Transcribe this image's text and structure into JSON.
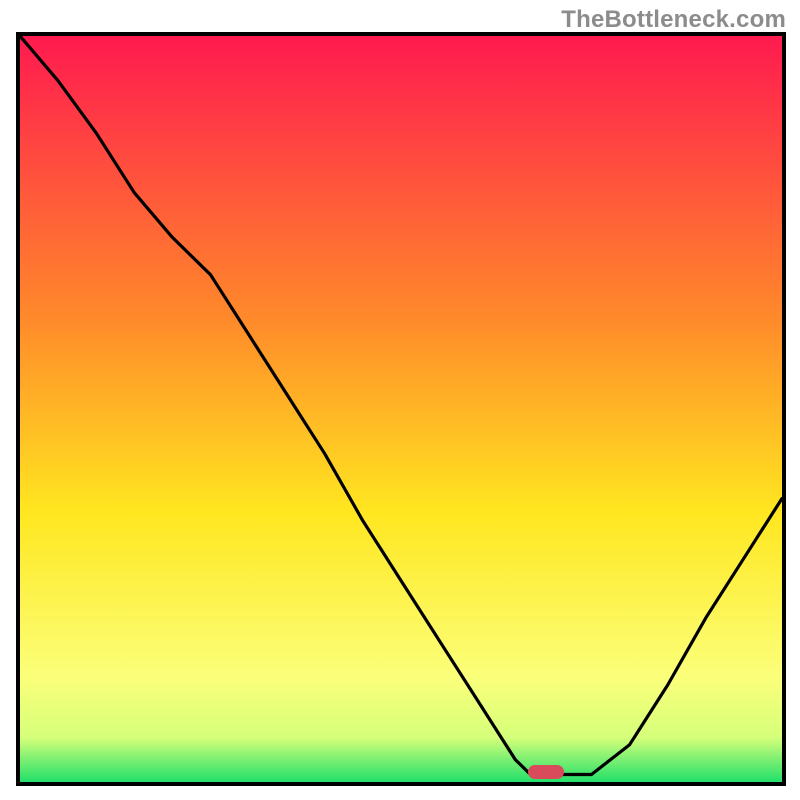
{
  "watermark": "TheBottleneck.com",
  "colors": {
    "gradient_top": "#ff1a4f",
    "gradient_mid1": "#ff8a2a",
    "gradient_mid2": "#ffe720",
    "gradient_mid3": "#fbff7a",
    "gradient_bottom": "#22e06a",
    "curve": "#000000",
    "marker": "#d94a5a",
    "frame": "#000000"
  },
  "chart_data": {
    "type": "line",
    "title": "",
    "xlabel": "",
    "ylabel": "",
    "xlim": [
      0,
      100
    ],
    "ylim": [
      0,
      100
    ],
    "series": [
      {
        "name": "curve",
        "x": [
          0,
          5,
          10,
          15,
          20,
          25,
          30,
          35,
          40,
          45,
          50,
          55,
          60,
          65,
          67,
          70,
          75,
          80,
          85,
          90,
          95,
          100
        ],
        "y": [
          100,
          94,
          87,
          79,
          73,
          68,
          60,
          52,
          44,
          35,
          27,
          19,
          11,
          3,
          1,
          1,
          1,
          5,
          13,
          22,
          30,
          38
        ]
      }
    ],
    "marker": {
      "x": 69,
      "y": 1.3
    },
    "grid": false
  }
}
